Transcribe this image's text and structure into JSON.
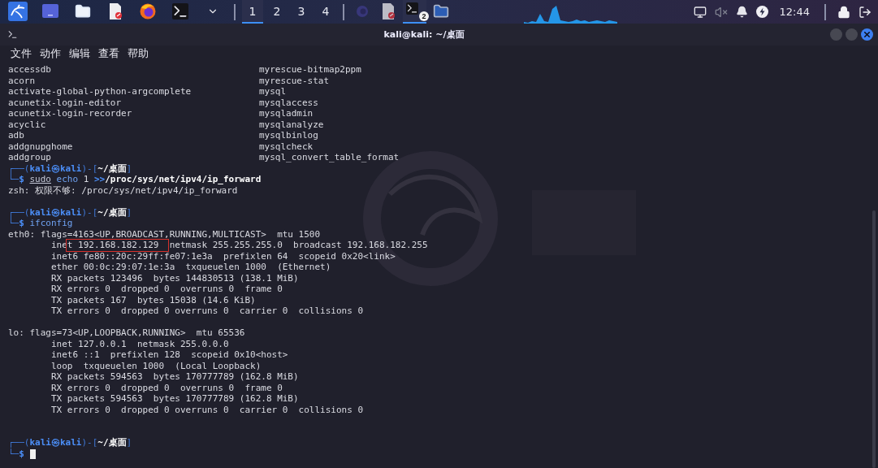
{
  "taskbar": {
    "launchers": [
      {
        "kind": "kali"
      },
      {
        "kind": "desktop"
      },
      {
        "kind": "folder"
      },
      {
        "kind": "document"
      },
      {
        "kind": "browser"
      },
      {
        "kind": "terminal"
      },
      {
        "kind": "chevron"
      }
    ],
    "workspaces": [
      {
        "label": "1",
        "selected": true
      },
      {
        "label": "2",
        "selected": false
      },
      {
        "label": "3",
        "selected": false
      },
      {
        "label": "4",
        "selected": false
      }
    ],
    "tasks": [
      {
        "kind": "app",
        "selected": false
      },
      {
        "kind": "document",
        "selected": false
      },
      {
        "kind": "terminal",
        "selected": true,
        "badge": "2"
      },
      {
        "kind": "folder",
        "selected": false
      }
    ],
    "tray": [
      {
        "kind": "network"
      },
      {
        "kind": "muted"
      },
      {
        "kind": "bell"
      },
      {
        "kind": "power"
      }
    ],
    "clock": "12:44",
    "session": [
      {
        "kind": "lock"
      },
      {
        "kind": "logout"
      }
    ]
  },
  "window": {
    "title": "kali@kali: ~/桌面",
    "controls": [
      {
        "kind": "minimize"
      },
      {
        "kind": "maximize"
      },
      {
        "kind": "close"
      }
    ]
  },
  "menu": [
    "文件",
    "动作",
    "编辑",
    "查看",
    "帮助"
  ],
  "terminal": {
    "lines": [
      {
        "kind": "columns",
        "cells": [
          "accessdb",
          "myrescue-bitmap2ppm"
        ]
      },
      {
        "kind": "columns",
        "cells": [
          "acorn",
          "myrescue-stat"
        ]
      },
      {
        "kind": "columns",
        "cells": [
          "activate-global-python-argcomplete",
          "mysql"
        ]
      },
      {
        "kind": "columns",
        "cells": [
          "acunetix-login-editor",
          "mysqlaccess"
        ]
      },
      {
        "kind": "columns",
        "cells": [
          "acunetix-login-recorder",
          "mysqladmin"
        ]
      },
      {
        "kind": "columns",
        "cells": [
          "acyclic",
          "mysqlanalyze"
        ]
      },
      {
        "kind": "columns",
        "cells": [
          "adb",
          "mysqlbinlog"
        ]
      },
      {
        "kind": "columns",
        "cells": [
          "addgnupghome",
          "mysqlcheck"
        ]
      },
      {
        "kind": "columns",
        "cells": [
          "addgroup",
          "mysql_convert_table_format"
        ]
      },
      {
        "kind": "text",
        "segments": [
          {
            "text": "┌──(",
            "kind": "frame"
          },
          {
            "text": "kali㉿kali",
            "kind": "user"
          },
          {
            "text": ")-[",
            "kind": "frame"
          },
          {
            "text": "~/桌面",
            "kind": "path"
          },
          {
            "text": "]",
            "kind": "frame"
          }
        ]
      },
      {
        "kind": "text",
        "segments": [
          {
            "text": "└─",
            "kind": "frame"
          },
          {
            "text": "$ ",
            "kind": "sign"
          },
          {
            "text": "sudo",
            "kind": "command"
          },
          {
            "text": " echo",
            "kind": "builtin"
          },
          {
            "text": " 1 ",
            "kind": "plain"
          },
          {
            "text": ">>",
            "kind": "redirect"
          },
          {
            "text": "/proc/sys/net/ipv4/ip_forward",
            "kind": "bold"
          }
        ]
      },
      {
        "kind": "text",
        "segments": [
          {
            "text": "zsh: 权限不够: /proc/sys/net/ipv4/ip_forward",
            "kind": "plain"
          }
        ]
      },
      {
        "kind": "blank"
      },
      {
        "kind": "text",
        "segments": [
          {
            "text": "┌──(",
            "kind": "frame"
          },
          {
            "text": "kali㉿kali",
            "kind": "user"
          },
          {
            "text": ")-[",
            "kind": "frame"
          },
          {
            "text": "~/桌面",
            "kind": "path"
          },
          {
            "text": "]",
            "kind": "frame"
          }
        ]
      },
      {
        "kind": "text",
        "segments": [
          {
            "text": "└─",
            "kind": "frame"
          },
          {
            "text": "$ ",
            "kind": "sign"
          },
          {
            "text": "ifconfig",
            "kind": "builtin"
          }
        ]
      },
      {
        "kind": "text",
        "segments": [
          {
            "text": "eth0: flags=4163<UP,BROADCAST,RUNNING,MULTICAST>  mtu 1500",
            "kind": "plain"
          }
        ]
      },
      {
        "kind": "text",
        "segments": [
          {
            "text": "        ine",
            "kind": "plain"
          },
          {
            "text": "t 192.168.182.129  ",
            "kind": "plain",
            "boxed": true
          },
          {
            "text": "netmask 255.255.255.0  broadcast 192.168.182.255",
            "kind": "plain"
          }
        ]
      },
      {
        "kind": "text",
        "segments": [
          {
            "text": "        inet6 fe80::20c:29ff:fe07:1e3a  prefixlen 64  scopeid 0x20<link>",
            "kind": "plain"
          }
        ]
      },
      {
        "kind": "text",
        "segments": [
          {
            "text": "        ether 00:0c:29:07:1e:3a  txqueuelen 1000  (Ethernet)",
            "kind": "plain"
          }
        ]
      },
      {
        "kind": "text",
        "segments": [
          {
            "text": "        RX packets 123496  bytes 144830513 (138.1 MiB)",
            "kind": "plain"
          }
        ]
      },
      {
        "kind": "text",
        "segments": [
          {
            "text": "        RX errors 0  dropped 0  overruns 0  frame 0",
            "kind": "plain"
          }
        ]
      },
      {
        "kind": "text",
        "segments": [
          {
            "text": "        TX packets 167  bytes 15038 (14.6 KiB)",
            "kind": "plain"
          }
        ]
      },
      {
        "kind": "text",
        "segments": [
          {
            "text": "        TX errors 0  dropped 0 overruns 0  carrier 0  collisions 0",
            "kind": "plain"
          }
        ]
      },
      {
        "kind": "blank"
      },
      {
        "kind": "text",
        "segments": [
          {
            "text": "lo: flags=73<UP,LOOPBACK,RUNNING>  mtu 65536",
            "kind": "plain"
          }
        ]
      },
      {
        "kind": "text",
        "segments": [
          {
            "text": "        inet 127.0.0.1  netmask 255.0.0.0",
            "kind": "plain"
          }
        ]
      },
      {
        "kind": "text",
        "segments": [
          {
            "text": "        inet6 ::1  prefixlen 128  scopeid 0x10<host>",
            "kind": "plain"
          }
        ]
      },
      {
        "kind": "text",
        "segments": [
          {
            "text": "        loop  txqueuelen 1000  (Local Loopback)",
            "kind": "plain"
          }
        ]
      },
      {
        "kind": "text",
        "segments": [
          {
            "text": "        RX packets 594563  bytes 170777789 (162.8 MiB)",
            "kind": "plain"
          }
        ]
      },
      {
        "kind": "text",
        "segments": [
          {
            "text": "        RX errors 0  dropped 0  overruns 0  frame 0",
            "kind": "plain"
          }
        ]
      },
      {
        "kind": "text",
        "segments": [
          {
            "text": "        TX packets 594563  bytes 170777789 (162.8 MiB)",
            "kind": "plain"
          }
        ]
      },
      {
        "kind": "text",
        "segments": [
          {
            "text": "        TX errors 0  dropped 0 overruns 0  carrier 0  collisions 0",
            "kind": "plain"
          }
        ]
      },
      {
        "kind": "blank"
      },
      {
        "kind": "blank"
      },
      {
        "kind": "text",
        "segments": [
          {
            "text": "┌──(",
            "kind": "frame"
          },
          {
            "text": "kali㉿kali",
            "kind": "user"
          },
          {
            "text": ")-[",
            "kind": "frame"
          },
          {
            "text": "~/桌面",
            "kind": "path"
          },
          {
            "text": "]",
            "kind": "frame"
          }
        ]
      },
      {
        "kind": "text",
        "segments": [
          {
            "text": "└─",
            "kind": "frame"
          },
          {
            "text": "$ ",
            "kind": "sign"
          }
        ],
        "cursor": true
      }
    ]
  }
}
